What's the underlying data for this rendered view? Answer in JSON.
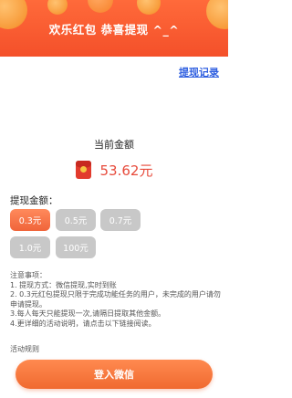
{
  "header": {
    "title": "欢乐红包 恭喜提现 ^_^"
  },
  "record_link": "提现记录",
  "balance": {
    "label": "当前金额",
    "value": "53.62元"
  },
  "withdraw": {
    "label": "提现金额：",
    "options": [
      "0.3元",
      "0.5元",
      "0.7元",
      "1.0元",
      "100元"
    ],
    "selected_index": 0
  },
  "notes": {
    "title": "注意事项：",
    "lines": [
      "1. 提现方式：微信提现,实时到账",
      "2. 0.3元红包提现只限于完成功能任务的用户，未完成的用户请勿申请提现。",
      "3.每人每天只能提现一次,请隔日提取其他金额。",
      "4.更详细的活动说明，请点击以下链接阅读。"
    ]
  },
  "rules_link": "活动规则",
  "login_button": "登入微信",
  "colors": {
    "accent": "#f4502a",
    "link": "#2f5fe0",
    "amount": "#e74a3b"
  }
}
